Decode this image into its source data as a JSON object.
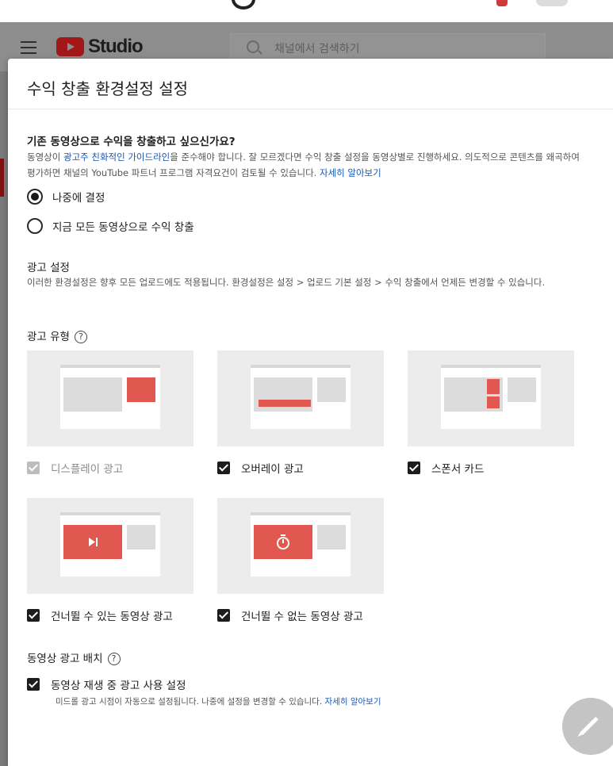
{
  "app": {
    "logo_text": "Studio",
    "search_placeholder": "채널에서 검색하기"
  },
  "dialog": {
    "title": "수익 창출 환경설정 설정",
    "existing": {
      "question": "기존 동영상으로 수익을 창출하고 싶으신가요?",
      "desc_1": "동영상이 ",
      "desc_link": "광고주 친화적인 가이드라인",
      "desc_2": "을 준수해야 합니다. 잘 모르겠다면 수익 창출 설정을 동영상별로 진행하세요. 의도적으로 콘텐츠를 왜곡하여 평가하면 채널의 YouTube 파트너 프로그램 자격요건이 검토될 수 있습니다. ",
      "learn_more": "자세히 알아보기",
      "options": [
        {
          "label": "나중에 결정",
          "selected": true
        },
        {
          "label": "지금 모든 동영상으로 수익 창출",
          "selected": false
        }
      ]
    },
    "ad_settings": {
      "title": "광고 설정",
      "desc": "이러한 환경설정은 향후 모든 업로드에도 적용됩니다. 환경설정은 설정 > 업로드 기본 설정 > 수익 창출에서 언제든 변경할 수 있습니다."
    },
    "ad_types": {
      "title": "광고 유형",
      "help_glyph": "?",
      "items": [
        {
          "label": "디스플레이 광고",
          "checked": true,
          "disabled": true
        },
        {
          "label": "오버레이 광고",
          "checked": true,
          "disabled": false
        },
        {
          "label": "스폰서 카드",
          "checked": true,
          "disabled": false
        },
        {
          "label": "건너뛸 수 있는 동영상 광고",
          "checked": true,
          "disabled": false
        },
        {
          "label": "건너뛸 수 없는 동영상 광고",
          "checked": true,
          "disabled": false
        }
      ]
    },
    "placement": {
      "title": "동영상 광고 배치",
      "help_glyph": "?",
      "option_label": "동영상 재생 중 광고 사용 설정",
      "option_checked": true,
      "note": "미드롤 광고 시점이 자동으로 설정됩니다. 나중에 설정을 변경할 수 있습니다. ",
      "note_link": "자세히 알아보기"
    }
  },
  "icons": [
    "menu-icon",
    "youtube-logo-icon",
    "search-icon",
    "help-icon",
    "play-skip-icon",
    "timer-icon",
    "edit-pencil-icon"
  ],
  "colors": {
    "accent_red": "#e0584f",
    "link_blue": "#1a57b5"
  }
}
